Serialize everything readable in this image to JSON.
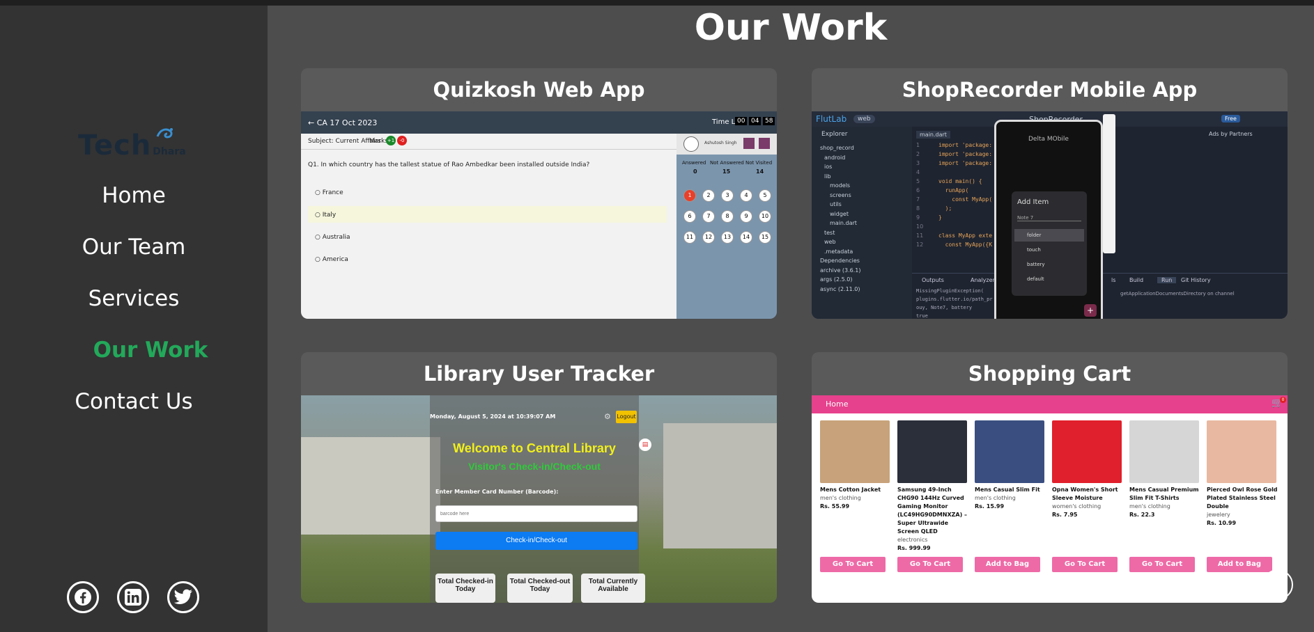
{
  "sidebar": {
    "logo": {
      "text": "Tech",
      "sub": "Dhara"
    },
    "nav": [
      "Home",
      "Our Team",
      "Services",
      "Our Work",
      "Contact Us"
    ],
    "active": "Our Work",
    "social": [
      "facebook-icon",
      "linkedin-icon",
      "twitter-icon"
    ]
  },
  "main": {
    "title": "Our Work",
    "cards": [
      {
        "title": "Quizkosh Web App"
      },
      {
        "title": "ShopRecorder Mobile App"
      },
      {
        "title": "Library User Tracker"
      },
      {
        "title": "Shopping Cart"
      }
    ]
  },
  "quiz": {
    "back": "← CA 17 Oct 2023",
    "time_left": "Time Left",
    "time": [
      "00",
      "04",
      "58"
    ],
    "subject": "Subject: Current Affairs",
    "marks": "Marks",
    "mark_pos": "+1",
    "mark_neg": "-0",
    "user": "Ashutosh Singh",
    "question": "Q1. In which country has the tallest statue of Rao Ambedkar been installed outside India?",
    "options": [
      "France",
      "Italy",
      "Australia",
      "America"
    ],
    "stats_labels": [
      "Answered",
      "Not Answered",
      "Not Visited"
    ],
    "stats": [
      "0",
      "15",
      "14"
    ],
    "palette": [
      "1",
      "2",
      "3",
      "4",
      "5",
      "6",
      "7",
      "8",
      "9",
      "10",
      "11",
      "12",
      "13",
      "14",
      "15"
    ]
  },
  "flutlab": {
    "brand": "FlutLab",
    "target": "web",
    "project": "ShopRecorder",
    "free": "Free",
    "explorer": "Explorer",
    "tree": [
      "shop_record",
      "android",
      "ios",
      "lib",
      "models",
      "screens",
      "utils",
      "widget",
      "main.dart",
      "test",
      "web",
      ".metadata",
      "Dependencies",
      "archive (3.6.1)",
      "args (2.5.0)",
      "async (2.11.0)"
    ],
    "tab": "main.dart",
    "code": [
      "import 'package:",
      "import 'package:",
      "import 'package:",
      "",
      "void main() {",
      "  runApp(",
      "    const MyApp(",
      "  );",
      "}",
      "",
      "class MyApp exte",
      "  const MyApp({K"
    ],
    "phone_title": "Delta MObile",
    "dialog_title": "Add Item",
    "dialog_input": "Note 7",
    "dialog_items": [
      "folder",
      "touch",
      "battery",
      "default"
    ],
    "ads": "Ads by Partners",
    "panel_tabs": [
      "Outputs",
      "Analyzer",
      "ls",
      "Build",
      "Run",
      "Git History"
    ],
    "console": [
      "MissingPluginException(",
      "plugins.flutter.io/path_pr",
      "ouy, Note7, battery",
      "true"
    ],
    "console_right": "getApplicationDocumentsDirectory on channel"
  },
  "library": {
    "datetime": "Monday, August 5, 2024 at 10:39:07 AM",
    "logout": "Logout",
    "welcome": "Welcome to Central Library",
    "sub": "Visitor's Check-in/Check-out",
    "label": "Enter Member Card Number (Barcode):",
    "placeholder": "barcode here",
    "button": "Check-in/Check-out",
    "stats": [
      "Total Checked-in Today",
      "Total Checked-out Today",
      "Total Currently Available"
    ]
  },
  "shop": {
    "nav": "Home",
    "cart_count": "0",
    "products": [
      {
        "name": "Mens Cotton Jacket",
        "cat": "men's clothing",
        "price": "Rs. 55.99",
        "btn": "Go To Cart",
        "color": "#c8a27a"
      },
      {
        "name": "Samsung 49-Inch CHG90 144Hz Curved Gaming Monitor (LC49HG90DMNXZA) – Super Ultrawide Screen QLED",
        "cat": "electronics",
        "price": "Rs. 999.99",
        "btn": "Go To Cart",
        "color": "#2a2f3a"
      },
      {
        "name": "Mens Casual Slim Fit",
        "cat": "men's clothing",
        "price": "Rs. 15.99",
        "btn": "Add to Bag",
        "color": "#3a4f80"
      },
      {
        "name": "Opna Women's Short Sleeve Moisture",
        "cat": "women's clothing",
        "price": "Rs. 7.95",
        "btn": "Go To Cart",
        "color": "#e0202c"
      },
      {
        "name": "Mens Casual Premium Slim Fit T-Shirts",
        "cat": "men's clothing",
        "price": "Rs. 22.3",
        "btn": "Go To Cart",
        "color": "#d6d6d6"
      },
      {
        "name": "Pierced Owl Rose Gold Plated Stainless Steel Double",
        "cat": "jewelery",
        "price": "Rs. 10.99",
        "btn": "Add to Bag",
        "color": "#e8b8a0"
      }
    ]
  }
}
